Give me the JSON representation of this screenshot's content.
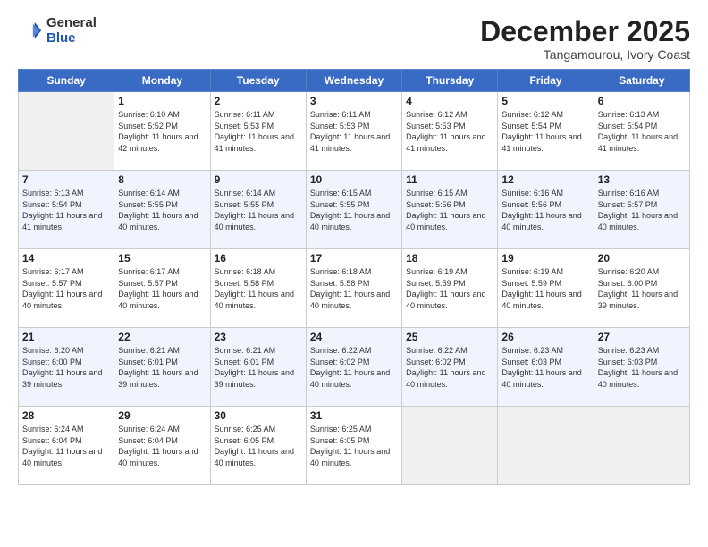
{
  "logo": {
    "general": "General",
    "blue": "Blue"
  },
  "title": "December 2025",
  "location": "Tangamourou, Ivory Coast",
  "days_of_week": [
    "Sunday",
    "Monday",
    "Tuesday",
    "Wednesday",
    "Thursday",
    "Friday",
    "Saturday"
  ],
  "weeks": [
    [
      {
        "day": "",
        "sunrise": "",
        "sunset": "",
        "daylight": ""
      },
      {
        "day": "1",
        "sunrise": "Sunrise: 6:10 AM",
        "sunset": "Sunset: 5:52 PM",
        "daylight": "Daylight: 11 hours and 42 minutes."
      },
      {
        "day": "2",
        "sunrise": "Sunrise: 6:11 AM",
        "sunset": "Sunset: 5:53 PM",
        "daylight": "Daylight: 11 hours and 41 minutes."
      },
      {
        "day": "3",
        "sunrise": "Sunrise: 6:11 AM",
        "sunset": "Sunset: 5:53 PM",
        "daylight": "Daylight: 11 hours and 41 minutes."
      },
      {
        "day": "4",
        "sunrise": "Sunrise: 6:12 AM",
        "sunset": "Sunset: 5:53 PM",
        "daylight": "Daylight: 11 hours and 41 minutes."
      },
      {
        "day": "5",
        "sunrise": "Sunrise: 6:12 AM",
        "sunset": "Sunset: 5:54 PM",
        "daylight": "Daylight: 11 hours and 41 minutes."
      },
      {
        "day": "6",
        "sunrise": "Sunrise: 6:13 AM",
        "sunset": "Sunset: 5:54 PM",
        "daylight": "Daylight: 11 hours and 41 minutes."
      }
    ],
    [
      {
        "day": "7",
        "sunrise": "Sunrise: 6:13 AM",
        "sunset": "Sunset: 5:54 PM",
        "daylight": "Daylight: 11 hours and 41 minutes."
      },
      {
        "day": "8",
        "sunrise": "Sunrise: 6:14 AM",
        "sunset": "Sunset: 5:55 PM",
        "daylight": "Daylight: 11 hours and 40 minutes."
      },
      {
        "day": "9",
        "sunrise": "Sunrise: 6:14 AM",
        "sunset": "Sunset: 5:55 PM",
        "daylight": "Daylight: 11 hours and 40 minutes."
      },
      {
        "day": "10",
        "sunrise": "Sunrise: 6:15 AM",
        "sunset": "Sunset: 5:55 PM",
        "daylight": "Daylight: 11 hours and 40 minutes."
      },
      {
        "day": "11",
        "sunrise": "Sunrise: 6:15 AM",
        "sunset": "Sunset: 5:56 PM",
        "daylight": "Daylight: 11 hours and 40 minutes."
      },
      {
        "day": "12",
        "sunrise": "Sunrise: 6:16 AM",
        "sunset": "Sunset: 5:56 PM",
        "daylight": "Daylight: 11 hours and 40 minutes."
      },
      {
        "day": "13",
        "sunrise": "Sunrise: 6:16 AM",
        "sunset": "Sunset: 5:57 PM",
        "daylight": "Daylight: 11 hours and 40 minutes."
      }
    ],
    [
      {
        "day": "14",
        "sunrise": "Sunrise: 6:17 AM",
        "sunset": "Sunset: 5:57 PM",
        "daylight": "Daylight: 11 hours and 40 minutes."
      },
      {
        "day": "15",
        "sunrise": "Sunrise: 6:17 AM",
        "sunset": "Sunset: 5:57 PM",
        "daylight": "Daylight: 11 hours and 40 minutes."
      },
      {
        "day": "16",
        "sunrise": "Sunrise: 6:18 AM",
        "sunset": "Sunset: 5:58 PM",
        "daylight": "Daylight: 11 hours and 40 minutes."
      },
      {
        "day": "17",
        "sunrise": "Sunrise: 6:18 AM",
        "sunset": "Sunset: 5:58 PM",
        "daylight": "Daylight: 11 hours and 40 minutes."
      },
      {
        "day": "18",
        "sunrise": "Sunrise: 6:19 AM",
        "sunset": "Sunset: 5:59 PM",
        "daylight": "Daylight: 11 hours and 40 minutes."
      },
      {
        "day": "19",
        "sunrise": "Sunrise: 6:19 AM",
        "sunset": "Sunset: 5:59 PM",
        "daylight": "Daylight: 11 hours and 40 minutes."
      },
      {
        "day": "20",
        "sunrise": "Sunrise: 6:20 AM",
        "sunset": "Sunset: 6:00 PM",
        "daylight": "Daylight: 11 hours and 39 minutes."
      }
    ],
    [
      {
        "day": "21",
        "sunrise": "Sunrise: 6:20 AM",
        "sunset": "Sunset: 6:00 PM",
        "daylight": "Daylight: 11 hours and 39 minutes."
      },
      {
        "day": "22",
        "sunrise": "Sunrise: 6:21 AM",
        "sunset": "Sunset: 6:01 PM",
        "daylight": "Daylight: 11 hours and 39 minutes."
      },
      {
        "day": "23",
        "sunrise": "Sunrise: 6:21 AM",
        "sunset": "Sunset: 6:01 PM",
        "daylight": "Daylight: 11 hours and 39 minutes."
      },
      {
        "day": "24",
        "sunrise": "Sunrise: 6:22 AM",
        "sunset": "Sunset: 6:02 PM",
        "daylight": "Daylight: 11 hours and 40 minutes."
      },
      {
        "day": "25",
        "sunrise": "Sunrise: 6:22 AM",
        "sunset": "Sunset: 6:02 PM",
        "daylight": "Daylight: 11 hours and 40 minutes."
      },
      {
        "day": "26",
        "sunrise": "Sunrise: 6:23 AM",
        "sunset": "Sunset: 6:03 PM",
        "daylight": "Daylight: 11 hours and 40 minutes."
      },
      {
        "day": "27",
        "sunrise": "Sunrise: 6:23 AM",
        "sunset": "Sunset: 6:03 PM",
        "daylight": "Daylight: 11 hours and 40 minutes."
      }
    ],
    [
      {
        "day": "28",
        "sunrise": "Sunrise: 6:24 AM",
        "sunset": "Sunset: 6:04 PM",
        "daylight": "Daylight: 11 hours and 40 minutes."
      },
      {
        "day": "29",
        "sunrise": "Sunrise: 6:24 AM",
        "sunset": "Sunset: 6:04 PM",
        "daylight": "Daylight: 11 hours and 40 minutes."
      },
      {
        "day": "30",
        "sunrise": "Sunrise: 6:25 AM",
        "sunset": "Sunset: 6:05 PM",
        "daylight": "Daylight: 11 hours and 40 minutes."
      },
      {
        "day": "31",
        "sunrise": "Sunrise: 6:25 AM",
        "sunset": "Sunset: 6:05 PM",
        "daylight": "Daylight: 11 hours and 40 minutes."
      },
      {
        "day": "",
        "sunrise": "",
        "sunset": "",
        "daylight": ""
      },
      {
        "day": "",
        "sunrise": "",
        "sunset": "",
        "daylight": ""
      },
      {
        "day": "",
        "sunrise": "",
        "sunset": "",
        "daylight": ""
      }
    ]
  ]
}
